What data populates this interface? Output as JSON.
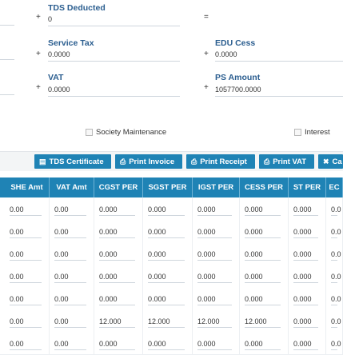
{
  "form": {
    "tds_label": "TDS Deducted",
    "tds_value": "0",
    "equals": "=",
    "service_tax_label": "Service Tax",
    "service_tax_value": "0.0000",
    "edu_cess_label": "EDU Cess",
    "edu_cess_value": "0.0000",
    "vat_label": "VAT",
    "vat_value": "0.0000",
    "ps_amount_label": "PS Amount",
    "ps_amount_value": "1057700.0000",
    "plus": "+"
  },
  "checks": {
    "society_maintenance": "Society Maintenance",
    "interest": "Interest"
  },
  "buttons": {
    "tds_certificate": "TDS Certificate",
    "print_invoice": "Print Invoice",
    "print_receipt": "Print Receipt",
    "print_vat": "Print VAT",
    "cancel": "Ca"
  },
  "table": {
    "columns": [
      "SHE Amt",
      "VAT Amt",
      "CGST PER",
      "SGST PER",
      "IGST PER",
      "CESS PER",
      "ST PER",
      "EC"
    ],
    "rows": [
      [
        "0.00",
        "0.00",
        "0.000",
        "0.000",
        "0.000",
        "0.000",
        "0.000",
        "0.0"
      ],
      [
        "0.00",
        "0.00",
        "0.000",
        "0.000",
        "0.000",
        "0.000",
        "0.000",
        "0.0"
      ],
      [
        "0.00",
        "0.00",
        "0.000",
        "0.000",
        "0.000",
        "0.000",
        "0.000",
        "0.0"
      ],
      [
        "0.00",
        "0.00",
        "0.000",
        "0.000",
        "0.000",
        "0.000",
        "0.000",
        "0.0"
      ],
      [
        "0.00",
        "0.00",
        "0.000",
        "0.000",
        "0.000",
        "0.000",
        "0.000",
        "0.0"
      ],
      [
        "0.00",
        "0.00",
        "12.000",
        "12.000",
        "12.000",
        "12.000",
        "0.000",
        "0.0"
      ],
      [
        "0.00",
        "0.00",
        "0.000",
        "0.000",
        "0.000",
        "0.000",
        "0.000",
        "0.0"
      ]
    ]
  },
  "colors": {
    "accent": "#1f83b5",
    "label": "#2a5d8f"
  }
}
